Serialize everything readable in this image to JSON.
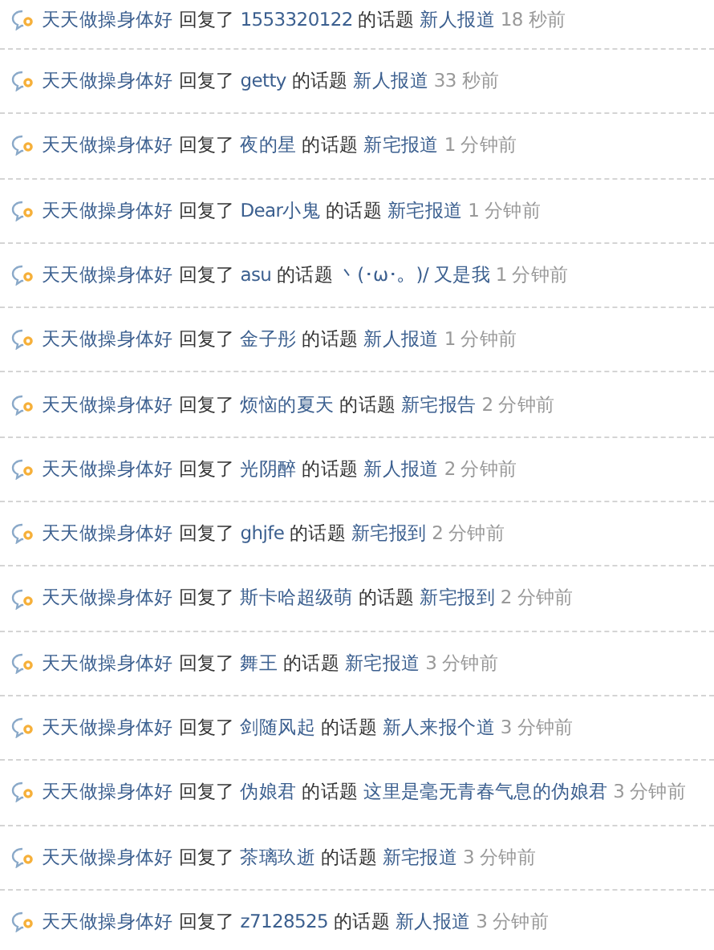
{
  "activities": [
    {
      "user": "天天做操身体好",
      "action": "回复了",
      "target": "1553320122",
      "of_topic": "的话题",
      "topic": "新人报道",
      "time": "18 秒前"
    },
    {
      "user": "天天做操身体好",
      "action": "回复了",
      "target": "getty",
      "of_topic": "的话题",
      "topic": "新人报道",
      "time": "33 秒前"
    },
    {
      "user": "天天做操身体好",
      "action": "回复了",
      "target": "夜的星",
      "of_topic": "的话题",
      "topic": "新宅报道",
      "time": "1 分钟前"
    },
    {
      "user": "天天做操身体好",
      "action": "回复了",
      "target": "Dear小鬼",
      "of_topic": "的话题",
      "topic": "新宅报道",
      "time": "1 分钟前"
    },
    {
      "user": "天天做操身体好",
      "action": "回复了",
      "target": "asu",
      "of_topic": "的话题",
      "topic": "丶(･ω･。)/ 又是我",
      "time": "1 分钟前"
    },
    {
      "user": "天天做操身体好",
      "action": "回复了",
      "target": "金子彤",
      "of_topic": "的话题",
      "topic": "新人报道",
      "time": "1 分钟前"
    },
    {
      "user": "天天做操身体好",
      "action": "回复了",
      "target": "烦恼的夏天",
      "of_topic": "的话题",
      "topic": "新宅报告",
      "time": "2 分钟前"
    },
    {
      "user": "天天做操身体好",
      "action": "回复了",
      "target": "光阴醉",
      "of_topic": "的话题",
      "topic": "新人报道",
      "time": "2 分钟前"
    },
    {
      "user": "天天做操身体好",
      "action": "回复了",
      "target": "ghjfe",
      "of_topic": "的话题",
      "topic": "新宅报到",
      "time": "2 分钟前"
    },
    {
      "user": "天天做操身体好",
      "action": "回复了",
      "target": "斯卡哈超级萌",
      "of_topic": "的话题",
      "topic": "新宅报到",
      "time": "2 分钟前"
    },
    {
      "user": "天天做操身体好",
      "action": "回复了",
      "target": "舞王",
      "of_topic": "的话题",
      "topic": "新宅报道",
      "time": "3 分钟前"
    },
    {
      "user": "天天做操身体好",
      "action": "回复了",
      "target": "剑随风起",
      "of_topic": "的话题",
      "topic": "新人来报个道",
      "time": "3 分钟前"
    },
    {
      "user": "天天做操身体好",
      "action": "回复了",
      "target": "伪娘君",
      "of_topic": "的话题",
      "topic": "这里是毫无青春气息的伪娘君",
      "time": "3 分钟前"
    },
    {
      "user": "天天做操身体好",
      "action": "回复了",
      "target": "茶璃玖逝",
      "of_topic": "的话题",
      "topic": "新宅报道",
      "time": "3 分钟前"
    },
    {
      "user": "天天做操身体好",
      "action": "回复了",
      "target": "z7128525",
      "of_topic": "的话题",
      "topic": "新人报道",
      "time": "3 分钟前"
    }
  ]
}
